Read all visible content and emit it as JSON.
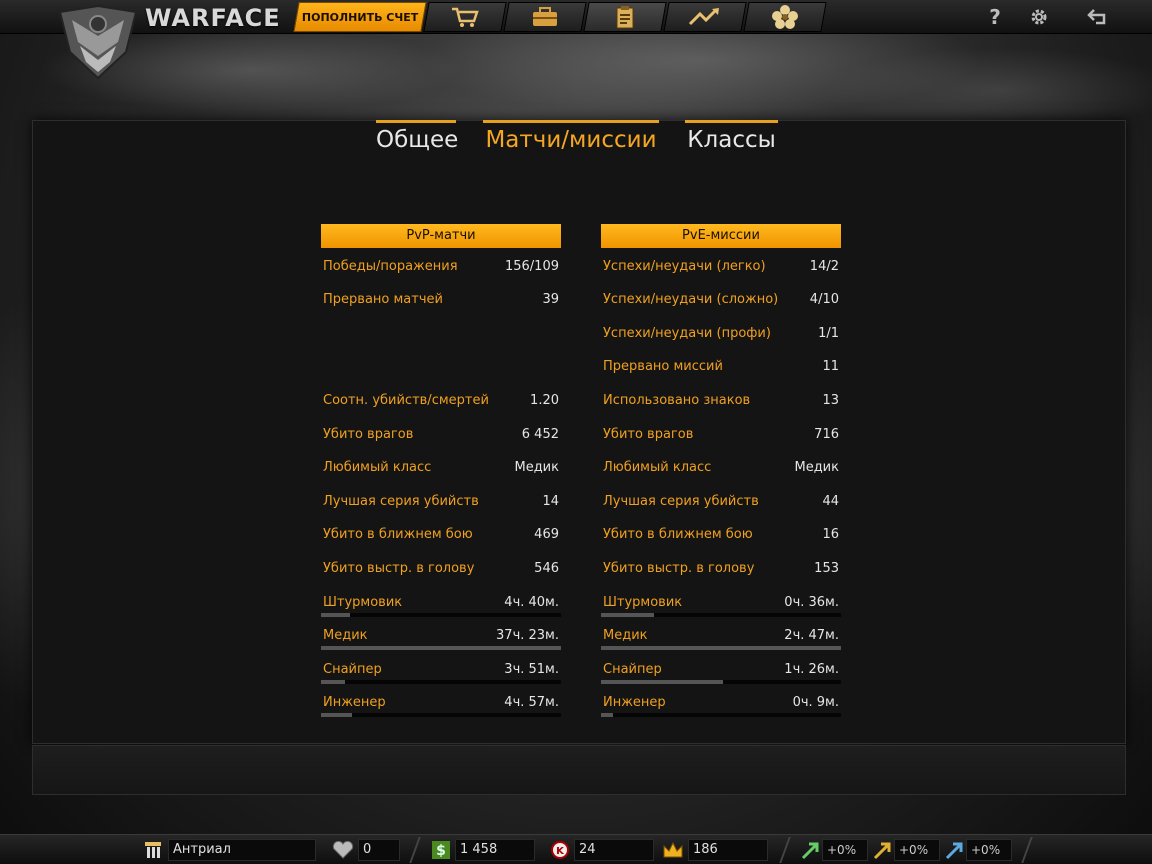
{
  "app": {
    "logo_text": "WARFACE"
  },
  "topbar": {
    "topup_label": "ПОПОЛНИТЬ СЧЕТ",
    "nav": [
      {
        "icon": "shopping-cart-icon"
      },
      {
        "icon": "briefcase-icon"
      },
      {
        "icon": "clipboard-icon"
      },
      {
        "icon": "trend-arrow-icon"
      },
      {
        "icon": "flower-icon"
      }
    ],
    "help_label": "?",
    "colors": {
      "accent": "#f5a623"
    }
  },
  "tabs": [
    {
      "label": "Общее",
      "active": false
    },
    {
      "label": "Матчи/миссии",
      "active": true
    },
    {
      "label": "Классы",
      "active": false
    }
  ],
  "pvp": {
    "header": "PvP-матчи",
    "rows": [
      {
        "label": "Победы/поражения",
        "value": "156/109"
      },
      {
        "label": "Прервано матчей",
        "value": "39"
      },
      {
        "label": "Соотн. убийств/смертей",
        "value": "1.20"
      },
      {
        "label": "Убито врагов",
        "value": "6 452"
      },
      {
        "label": "Любимый класс",
        "value": "Медик"
      },
      {
        "label": "Лучшая серия убийств",
        "value": "14"
      },
      {
        "label": "Убито в ближнем бою",
        "value": "469"
      },
      {
        "label": "Убито выстр. в голову",
        "value": "546"
      }
    ],
    "classes": [
      {
        "label": "Штурмовик",
        "value": "4ч. 40м.",
        "fill": 0.12
      },
      {
        "label": "Медик",
        "value": "37ч. 23м.",
        "fill": 1.0
      },
      {
        "label": "Снайпер",
        "value": "3ч. 51м.",
        "fill": 0.1
      },
      {
        "label": "Инженер",
        "value": "4ч. 57м.",
        "fill": 0.13
      }
    ]
  },
  "pve": {
    "header": "PvE-миссии",
    "rows": [
      {
        "label": "Успехи/неудачи (легко)",
        "value": "14/2"
      },
      {
        "label": "Успехи/неудачи (сложно)",
        "value": "4/10"
      },
      {
        "label": "Успехи/неудачи (профи)",
        "value": "1/1"
      },
      {
        "label": "Прервано миссий",
        "value": "11"
      },
      {
        "label": "Использовано знаков",
        "value": "13"
      },
      {
        "label": "Убито врагов",
        "value": "716"
      },
      {
        "label": "Любимый класс",
        "value": "Медик"
      },
      {
        "label": "Лучшая серия убийств",
        "value": "44"
      },
      {
        "label": "Убито в ближнем бою",
        "value": "16"
      },
      {
        "label": "Убито выстр. в голову",
        "value": "153"
      }
    ],
    "classes": [
      {
        "label": "Штурмовик",
        "value": "0ч. 36м.",
        "fill": 0.22
      },
      {
        "label": "Медик",
        "value": "2ч. 47м.",
        "fill": 1.0
      },
      {
        "label": "Снайпер",
        "value": "1ч. 26м.",
        "fill": 0.51
      },
      {
        "label": "Инженер",
        "value": "0ч. 9м.",
        "fill": 0.05
      }
    ]
  },
  "bottombar": {
    "player_name": "Антриал",
    "hearts": "0",
    "money": "1 458",
    "kredits": "24",
    "crowns": "186",
    "boost_xp": "+0%",
    "boost_vp": "+0%",
    "boost_money": "+0%"
  }
}
